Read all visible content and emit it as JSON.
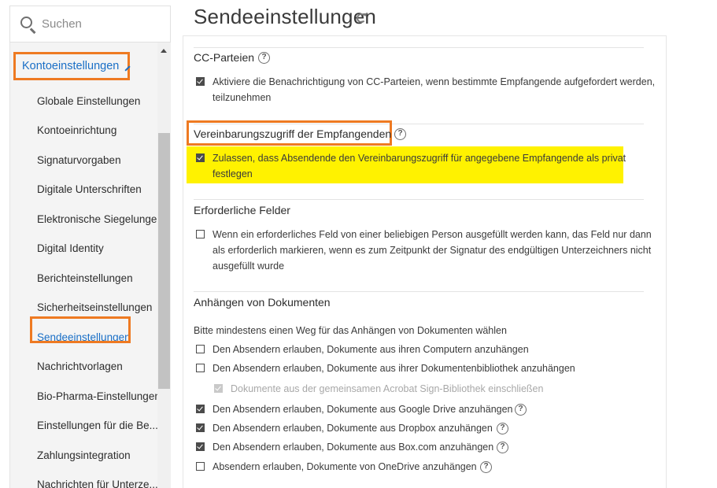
{
  "sidebar": {
    "search_placeholder": "Suchen",
    "section_label": "Kontoeinstellungen",
    "items": [
      {
        "label": "Globale Einstellungen"
      },
      {
        "label": "Kontoeinrichtung"
      },
      {
        "label": "Signaturvorgaben"
      },
      {
        "label": "Digitale Unterschriften"
      },
      {
        "label": "Elektronische Siegelungen"
      },
      {
        "label": "Digital Identity"
      },
      {
        "label": "Berichteinstellungen"
      },
      {
        "label": "Sicherheitseinstellungen"
      },
      {
        "label": "Sendeeinstellungen"
      },
      {
        "label": "Nachrichtvorlagen"
      },
      {
        "label": "Bio-Pharma-Einstellungen"
      },
      {
        "label": "Einstellungen für die Be..."
      },
      {
        "label": "Zahlungsintegration"
      },
      {
        "label": "Nachrichten für Unterze..."
      }
    ],
    "active_item": "Sendeeinstellungen"
  },
  "page": {
    "title": "Sendeeinstellungen"
  },
  "sections": {
    "cc": {
      "title": "CC-Parteien",
      "option": "Aktiviere die Benachrichtigung von CC-Parteien, wenn bestimmte Empfangende aufgefordert werden,",
      "option_line2": "teilzunehmen",
      "checked": true
    },
    "access": {
      "title": "Vereinbarungszugriff der Empfangenden",
      "option": "Zulassen, dass Absendende den Vereinbarungszugriff für angegebene Empfangende als privat",
      "option_line2": "festlegen",
      "checked": true
    },
    "required": {
      "title": "Erforderliche Felder",
      "option_line1": "Wenn ein erforderliches Feld von einer beliebigen Person ausgefüllt werden kann, das Feld nur dann",
      "option_line2": "als erforderlich markieren, wenn es zum Zeitpunkt der Signatur des endgültigen Unterzeichners nicht",
      "option_line3": "ausgefüllt wurde",
      "checked": false
    },
    "attach": {
      "title": "Anhängen von Dokumenten",
      "intro": "Bitte mindestens einen Weg für das Anhängen von Dokumenten wählen",
      "options": [
        {
          "label": "Den Absendern erlauben, Dokumente aus ihren Computern anzuhängen",
          "checked": false
        },
        {
          "label": "Den Absendern erlauben, Dokumente aus ihrer Dokumentenbibliothek anzuhängen",
          "checked": false
        },
        {
          "label": "Dokumente aus der gemeinsamen Acrobat Sign-Bibliothek einschließen",
          "checked": true,
          "disabled": true
        },
        {
          "label": "Den Absendern erlauben, Dokumente aus Google Drive anzuhängen",
          "checked": true
        },
        {
          "label": "Den Absendern erlauben, Dokumente aus Dropbox anzuhängen",
          "checked": true
        },
        {
          "label": "Den Absendern erlauben, Dokumente aus Box.com anzuhängen",
          "checked": true
        },
        {
          "label": "Absendern erlauben, Dokumente von OneDrive anzuhängen",
          "checked": false
        }
      ]
    }
  },
  "icons": {
    "help": "?"
  },
  "colors": {
    "accent": "#1a6fc6",
    "callout": "#ee7a22",
    "highlight": "#fff200"
  }
}
